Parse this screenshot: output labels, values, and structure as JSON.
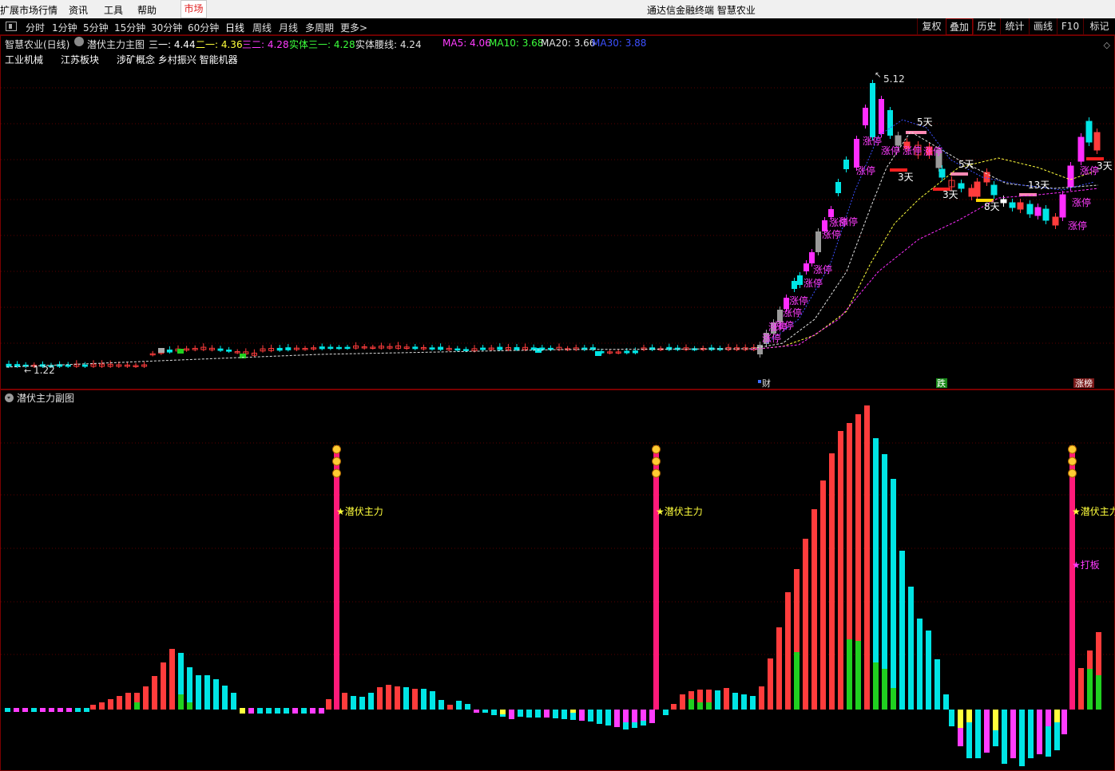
{
  "menu": {
    "items": [
      "扩展市场行情",
      "资讯",
      "工具",
      "帮助"
    ],
    "market_tab": "市场",
    "window_title": "通达信金融终端 智慧农业"
  },
  "periods": {
    "items": [
      "分时",
      "1分钟",
      "5分钟",
      "15分钟",
      "30分钟",
      "60分钟",
      "日线",
      "周线",
      "月线",
      "多周期",
      "更多>"
    ],
    "active": "日线"
  },
  "right_tools": [
    "复权",
    "叠加",
    "历史",
    "统计",
    "画线",
    "F10",
    "标记"
  ],
  "main_info": {
    "stock": "智慧农业(日线)",
    "indicator": "潜伏主力主图",
    "lines": [
      {
        "label": "三一: 4.44",
        "color": "#ffffff"
      },
      {
        "label": "二一: 4.36",
        "color": "#ffff3c"
      },
      {
        "label": "三二: 4.28",
        "color": "#ff3cff"
      },
      {
        "label": "实体三一: 4.28",
        "color": "#3cff3c"
      },
      {
        "label": "实体腰线: 4.24",
        "color": "#e0e0e0"
      }
    ],
    "ma": [
      {
        "label": "MA5: 4.06",
        "color": "#ff3cff"
      },
      {
        "label": "MA10: 3.68",
        "color": "#3cff3c"
      },
      {
        "label": "MA20: 3.66",
        "color": "#e0e0e0"
      },
      {
        "label": "MA30: 3.88",
        "color": "#3c50ff"
      }
    ]
  },
  "concepts": [
    "工业机械",
    "江苏板块",
    "涉矿概念 乡村振兴 智能机器"
  ],
  "chart_labels": {
    "high": "5.12",
    "low": "1.22",
    "limit_up": "涨停",
    "days": [
      "5天",
      "3天",
      "3天",
      "5天",
      "8天",
      "13天",
      "3天"
    ],
    "events": [
      "财",
      "跌",
      "涨榜"
    ]
  },
  "sub": {
    "title": "潜伏主力副图",
    "signal": "★潜伏主力",
    "signal2": "★打板"
  },
  "colors": {
    "up": "#ff3c3c",
    "down": "#00e5e5",
    "limit": "#ff2dff",
    "pink_bar": "#ff1a7a",
    "yellow": "#ffff3c",
    "green": "#20d020"
  }
}
